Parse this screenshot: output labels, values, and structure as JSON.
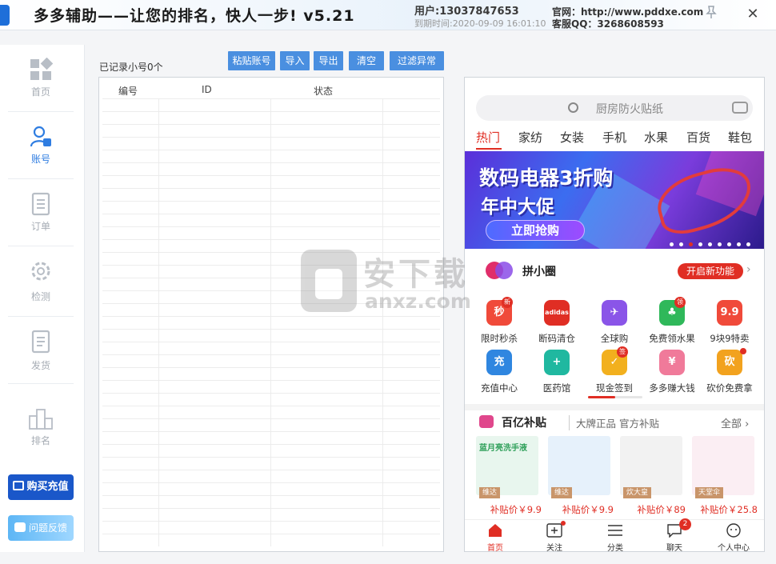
{
  "titlebar": {
    "title": "多多辅助——让您的排名，快人一步! v5.21",
    "user": "用户:13037847653",
    "expire": "到期时间:2020-09-09 16:01:10",
    "website": "官网：http://www.pddxe.com",
    "qq": "客服QQ：3268608593",
    "pin_icon": "pin-icon",
    "close_label": "✕"
  },
  "sidebar": {
    "items": [
      {
        "label": "首页",
        "icon": "home-grid-icon",
        "active": false
      },
      {
        "label": "账号",
        "icon": "user-account-icon",
        "active": true
      },
      {
        "label": "订单",
        "icon": "order-list-icon",
        "active": false
      },
      {
        "label": "检测",
        "icon": "gear-check-icon",
        "active": false
      },
      {
        "label": "发货",
        "icon": "shipping-doc-icon",
        "active": false
      },
      {
        "label": "排名",
        "icon": "podium-icon",
        "active": false
      }
    ],
    "buy_label": "购买充值",
    "feedback_label": "问题反馈"
  },
  "toolbar": {
    "recorded_text": "已记录小号0个",
    "buttons": [
      "粘贴账号",
      "导入",
      "导出",
      "清空",
      "过滤异常"
    ]
  },
  "table": {
    "columns": [
      "编号",
      "ID",
      "状态"
    ],
    "rows": []
  },
  "phone": {
    "search_placeholder": "厨房防火贴纸",
    "categories": [
      "热门",
      "家纺",
      "女装",
      "手机",
      "水果",
      "百货",
      "鞋包"
    ],
    "active_category": "热门",
    "banner": {
      "line1": "数码电器3折购",
      "line2": "年中大促",
      "button": "立即抢购"
    },
    "pinxiaoquan": {
      "name": "拼小圈",
      "open_label": "开启新功能"
    },
    "grid": [
      {
        "label": "限时秒杀",
        "glyph": "秒",
        "badge": "新",
        "color": "#f04a3a"
      },
      {
        "label": "断码清仓",
        "glyph": "adidas",
        "badge": "",
        "color": "#e02e24"
      },
      {
        "label": "全球购",
        "glyph": "✈",
        "badge": "",
        "color": "#8a55e8"
      },
      {
        "label": "免费领水果",
        "glyph": "♣",
        "badge": "领",
        "color": "#2fb85a"
      },
      {
        "label": "9块9特卖",
        "glyph": "9.9",
        "badge": "",
        "color": "#f04a3a"
      },
      {
        "label": "充值中心",
        "glyph": "充",
        "badge": "",
        "color": "#2f86e0"
      },
      {
        "label": "医药馆",
        "glyph": "+",
        "badge": "",
        "color": "#20b8a0"
      },
      {
        "label": "现金签到",
        "glyph": "✓",
        "badge": "签",
        "color": "#f2b01e"
      },
      {
        "label": "多多赚大钱",
        "glyph": "¥",
        "badge": "",
        "color": "#f07a9a"
      },
      {
        "label": "砍价免费拿",
        "glyph": "砍",
        "badge": "dot",
        "color": "#f2a21e"
      }
    ],
    "subsidy": {
      "title": "百亿补贴",
      "subtitle": "大牌正品 官方补贴",
      "all_label": "全部 ›"
    },
    "products": [
      {
        "brand": "维达",
        "price": "补贴价￥9.9",
        "color": "#e8f6ee",
        "img_text": "蓝月亮洗手液"
      },
      {
        "brand": "维达",
        "price": "补贴价￥9.9",
        "color": "#e6f1fb",
        "img_text": ""
      },
      {
        "brand": "炊大皇",
        "price": "补贴价￥89",
        "color": "#f2f2f2",
        "img_text": ""
      },
      {
        "brand": "天堂伞",
        "price": "补贴价￥25.8",
        "color": "#fbeef3",
        "img_text": ""
      }
    ],
    "bottom_nav": [
      {
        "label": "首页",
        "icon": "home-icon",
        "active": true,
        "count": ""
      },
      {
        "label": "关注",
        "icon": "follow-plus-icon",
        "active": false,
        "count": "dot"
      },
      {
        "label": "分类",
        "icon": "category-list-icon",
        "active": false,
        "count": ""
      },
      {
        "label": "聊天",
        "icon": "chat-bubble-icon",
        "active": false,
        "count": "2"
      },
      {
        "label": "个人中心",
        "icon": "profile-face-icon",
        "active": false,
        "count": ""
      }
    ]
  },
  "watermark": {
    "big": "安下载",
    "small": "anxz.com"
  },
  "colors": {
    "accent": "#2f7de1",
    "button": "#4a8fe0",
    "buy": "#1a57c9",
    "pdd_red": "#e02e24"
  }
}
